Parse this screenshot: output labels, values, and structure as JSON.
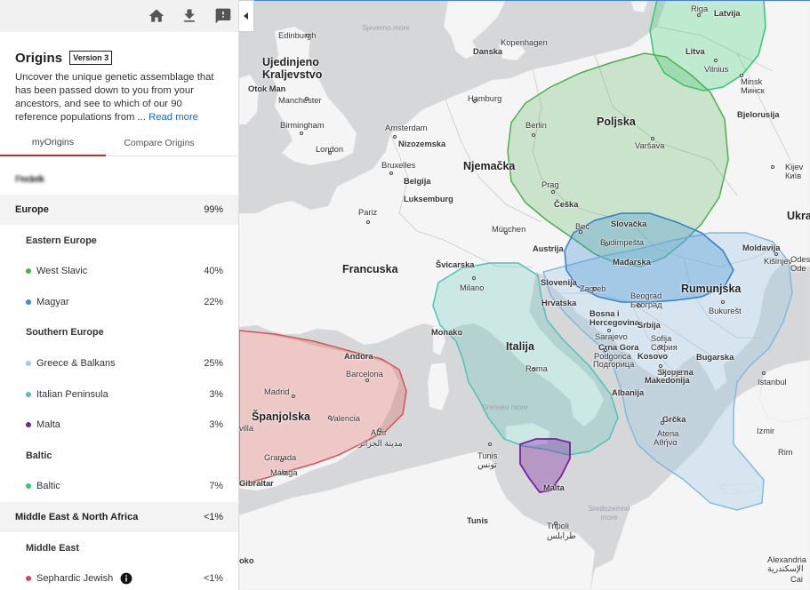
{
  "toolbar": {
    "home_icon": "home-icon",
    "download_icon": "download-icon",
    "feedback_icon": "feedback-icon"
  },
  "header": {
    "title": "Origins",
    "version": "Version 3",
    "description": "Uncover the unique genetic assemblage that has been passed down to you from your ancestors, and see to which of our 90 reference populations from ...",
    "read_more": "Read more"
  },
  "tabs": [
    {
      "label": "myOrigins"
    },
    {
      "label": "Compare Origins"
    }
  ],
  "user_name": "Frederik",
  "list": [
    {
      "kind": "region",
      "label": "Europe",
      "pct": "99%"
    },
    {
      "kind": "sub",
      "label": "Eastern Europe"
    },
    {
      "kind": "pop",
      "label": "West Slavic",
      "pct": "40%",
      "color": "#4caf50"
    },
    {
      "kind": "pop",
      "label": "Magyar",
      "pct": "22%",
      "color": "#3b8fd8"
    },
    {
      "kind": "sub",
      "label": "Southern Europe"
    },
    {
      "kind": "pop",
      "label": "Greece & Balkans",
      "pct": "25%",
      "color": "#9fc9e6"
    },
    {
      "kind": "pop",
      "label": "Italian Peninsula",
      "pct": "3%",
      "color": "#4fc3b8"
    },
    {
      "kind": "pop",
      "label": "Malta",
      "pct": "3%",
      "color": "#7b1fa2"
    },
    {
      "kind": "sub",
      "label": "Baltic"
    },
    {
      "kind": "pop",
      "label": "Baltic",
      "pct": "7%",
      "color": "#2ecc71"
    },
    {
      "kind": "region",
      "label": "Middle East & North Africa",
      "pct": "<1%"
    },
    {
      "kind": "sub",
      "label": "Middle East"
    },
    {
      "kind": "pop",
      "label": "Sephardic Jewish",
      "pct": "<1%",
      "color": "#e0405c",
      "info": true
    }
  ],
  "map": {
    "countries": [
      {
        "text": "Ujedinjeno",
        "cls": "country"
      },
      {
        "text": "Kraljevstvo",
        "cls": "country"
      },
      {
        "text": "Njemačka",
        "cls": "country"
      },
      {
        "text": "Poljska",
        "cls": "country"
      },
      {
        "text": "Francuska",
        "cls": "country"
      },
      {
        "text": "Italija",
        "cls": "country"
      },
      {
        "text": "Rumunjska",
        "cls": "country"
      },
      {
        "text": "Španjolska",
        "cls": "country"
      },
      {
        "text": "Ukra",
        "cls": "country"
      },
      {
        "text": "Latvija",
        "cls": "country-s"
      },
      {
        "text": "Litva",
        "cls": "country-s"
      },
      {
        "text": "Bjelorusija",
        "cls": "country-s"
      },
      {
        "text": "Danska",
        "cls": "country-s"
      },
      {
        "text": "Nizozemska",
        "cls": "country-s"
      },
      {
        "text": "Belgija",
        "cls": "country-s"
      },
      {
        "text": "Luksemburg",
        "cls": "country-s"
      },
      {
        "text": "Češka",
        "cls": "country-s"
      },
      {
        "text": "Slovačka",
        "cls": "country-s"
      },
      {
        "text": "Austrija",
        "cls": "country-s"
      },
      {
        "text": "Švicarska",
        "cls": "country-s"
      },
      {
        "text": "Mađarska",
        "cls": "country-s"
      },
      {
        "text": "Slovenija",
        "cls": "country-s"
      },
      {
        "text": "Hrvatska",
        "cls": "country-s"
      },
      {
        "text": "Bosna i",
        "cls": "country-s"
      },
      {
        "text": "Hercegovina",
        "cls": "country-s"
      },
      {
        "text": "Srbija",
        "cls": "country-s"
      },
      {
        "text": "Crna Gora",
        "cls": "country-s"
      },
      {
        "text": "Kosovo",
        "cls": "country-s"
      },
      {
        "text": "Sjeverna",
        "cls": "country-s"
      },
      {
        "text": "Makedonija",
        "cls": "country-s"
      },
      {
        "text": "Bugarska",
        "cls": "country-s"
      },
      {
        "text": "Albanija",
        "cls": "country-s"
      },
      {
        "text": "Grčka",
        "cls": "country-s"
      },
      {
        "text": "Monako",
        "cls": "country-s"
      },
      {
        "text": "Andora",
        "cls": "country-s"
      },
      {
        "text": "Moldavija",
        "cls": "country-s"
      },
      {
        "text": "Otok Man",
        "cls": "country-s"
      },
      {
        "text": "Tunis",
        "cls": "country-s"
      },
      {
        "text": "Malta",
        "cls": "country-s"
      },
      {
        "text": "Gibraltar",
        "cls": "country-s"
      },
      {
        "text": "oko",
        "cls": "country-s"
      }
    ],
    "cities": [
      "Riga",
      "Vilnius",
      "Minsk",
      "Минск",
      "Edinburgh",
      "Kopenhagen",
      "Hamburg",
      "Manchester",
      "Birmingham",
      "Amsterdam",
      "London",
      "Berlin",
      "Varšava",
      "Bruxelles",
      "Prag",
      "Pariz",
      "München",
      "Beč",
      "Budimpešta",
      "Milano",
      "Zagreb",
      "Beograd",
      "Београд",
      "Sarajevo",
      "Podgorica",
      "Подгорица",
      "Sofija",
      "София",
      "Skopje",
      "Bukurešt",
      "Kišinjev",
      "Rim",
      "Roma",
      "Barcelona",
      "Madrid",
      "Valencia",
      "Granada",
      "Málaga",
      "Alžir",
      "مدينة الجزائر",
      "Tunis",
      "تونس",
      "Tripoli",
      "طرابلس",
      "Atena",
      "Αθήνα",
      "Istanbul",
      "Izmir",
      "Alexandria",
      "الإسكندرية",
      "Cai",
      "Kijev",
      "Київ",
      "Odes",
      "Ode",
      "villa"
    ],
    "seas": [
      "Sjeverno more",
      "Tirensko more",
      "Sredozemno more"
    ],
    "region_colors": {
      "baltic": "#2ecc71",
      "west_slavic": "#4caf50",
      "magyar": "#3b8fd8",
      "balkans": "#9fc9e6",
      "italian": "#4fc3b8",
      "malta": "#7b1fa2",
      "iberian": "#d9534f"
    }
  }
}
